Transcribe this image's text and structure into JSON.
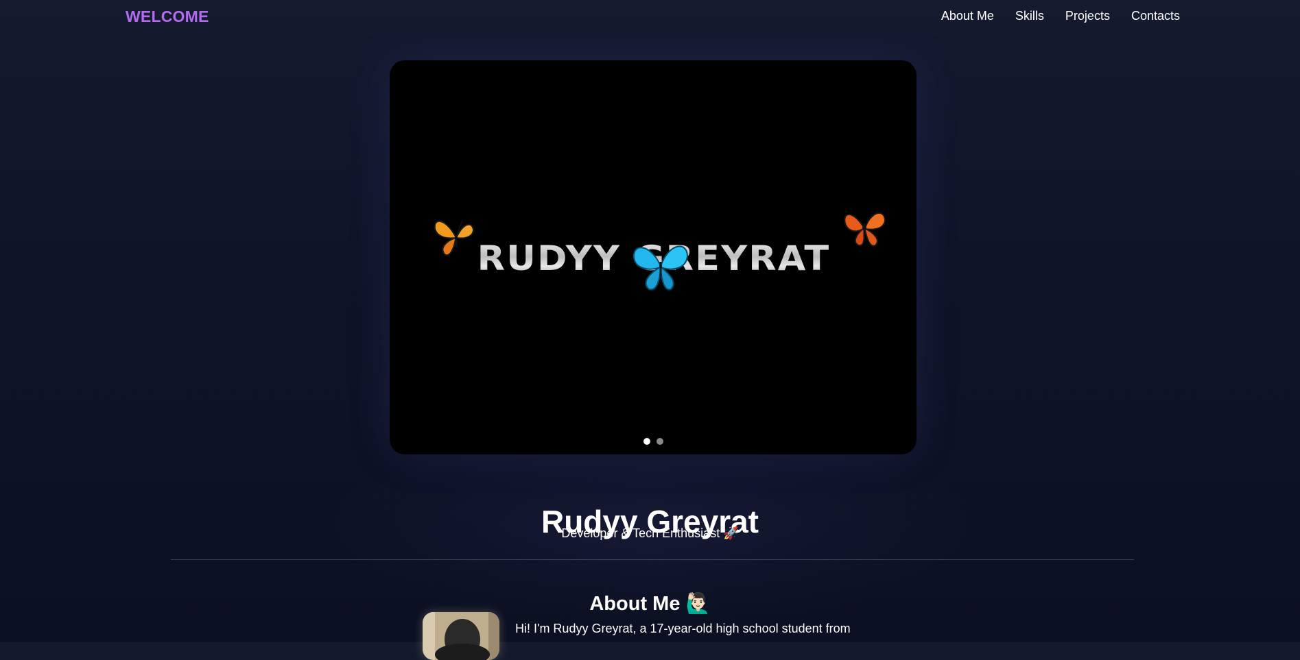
{
  "nav": {
    "brand": "WELCOME",
    "links": [
      "About Me",
      "Skills",
      "Projects",
      "Contacts"
    ]
  },
  "hero": {
    "logo_text": "RUDYY GREYRAT",
    "slides_total": 2,
    "active_slide": 1
  },
  "profile": {
    "name": "Rudyy Greyrat",
    "tagline": "Developer & Tech Enthusiast 🚀"
  },
  "about": {
    "title": "About Me 🙋🏻‍♂️",
    "intro": "Hi! I'm Rudyy Greyrat, a 17-year-old high school student from"
  },
  "colors": {
    "brand": "#b36cf0",
    "background": "#0f1528",
    "butterfly_orange": "#f08a1c",
    "butterfly_blue": "#1fb6ea"
  },
  "icons": [
    "butterfly-orange-icon",
    "butterfly-blue-icon",
    "butterfly-red-icon"
  ]
}
